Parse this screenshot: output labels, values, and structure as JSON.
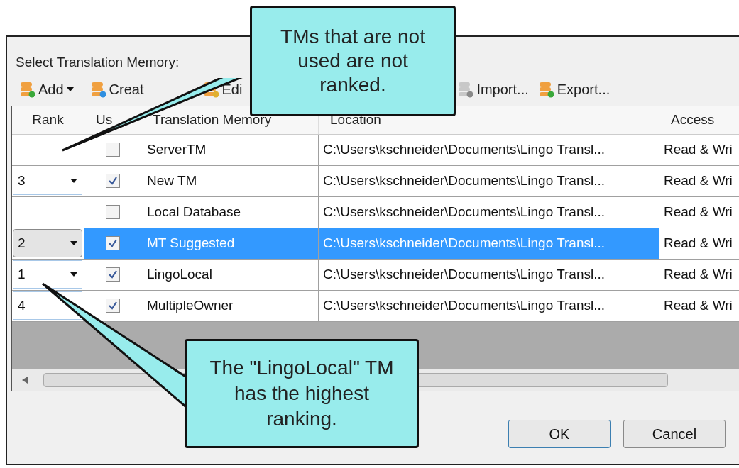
{
  "dialog": {
    "label": "Select Translation Memory:",
    "toolbar": [
      {
        "kind": "add",
        "label": "Add",
        "dropdown": true
      },
      {
        "kind": "create",
        "label": "Creat",
        "dropdown": false
      },
      {
        "kind": "edit",
        "label": "Edi",
        "dropdown": false
      },
      {
        "kind": "import",
        "label": "Import...",
        "dropdown": false
      },
      {
        "kind": "export",
        "label": "Export...",
        "dropdown": false
      }
    ],
    "columns": [
      "Rank",
      "Us",
      "Translation Memory",
      "Location",
      "Access"
    ],
    "rows": [
      {
        "rank": {
          "kind": "none"
        },
        "used": false,
        "name": "ServerTM",
        "location": "C:\\Users\\kschneider\\Documents\\Lingo Transl...",
        "access": "Read & Wri",
        "selected": false
      },
      {
        "rank": {
          "kind": "combo",
          "value": "3"
        },
        "used": true,
        "name": "New TM",
        "location": "C:\\Users\\kschneider\\Documents\\Lingo Transl...",
        "access": "Read & Wri",
        "selected": false
      },
      {
        "rank": {
          "kind": "none"
        },
        "used": false,
        "name": "Local Database",
        "location": "C:\\Users\\kschneider\\Documents\\Lingo Transl...",
        "access": "Read & Wri",
        "selected": false
      },
      {
        "rank": {
          "kind": "combo",
          "value": "2"
        },
        "used": true,
        "name": "MT Suggested",
        "location": "C:\\Users\\kschneider\\Documents\\Lingo Transl...",
        "access": "Read & Wri",
        "selected": true
      },
      {
        "rank": {
          "kind": "combo",
          "value": "1"
        },
        "used": true,
        "name": "LingoLocal",
        "location": "C:\\Users\\kschneider\\Documents\\Lingo Transl...",
        "access": "Read & Wri",
        "selected": false
      },
      {
        "rank": {
          "kind": "text",
          "value": "4"
        },
        "used": true,
        "name": "MultipleOwner",
        "location": "C:\\Users\\kschneider\\Documents\\Lingo Transl...",
        "access": "Read & Wri",
        "selected": false
      }
    ],
    "buttons": [
      {
        "label": "OK",
        "default": true
      },
      {
        "label": "Cancel",
        "default": false
      }
    ]
  },
  "callouts": [
    {
      "text": "TMs that are not used are not ranked."
    },
    {
      "text": "The \"LingoLocal\" TM has the highest ranking."
    }
  ]
}
